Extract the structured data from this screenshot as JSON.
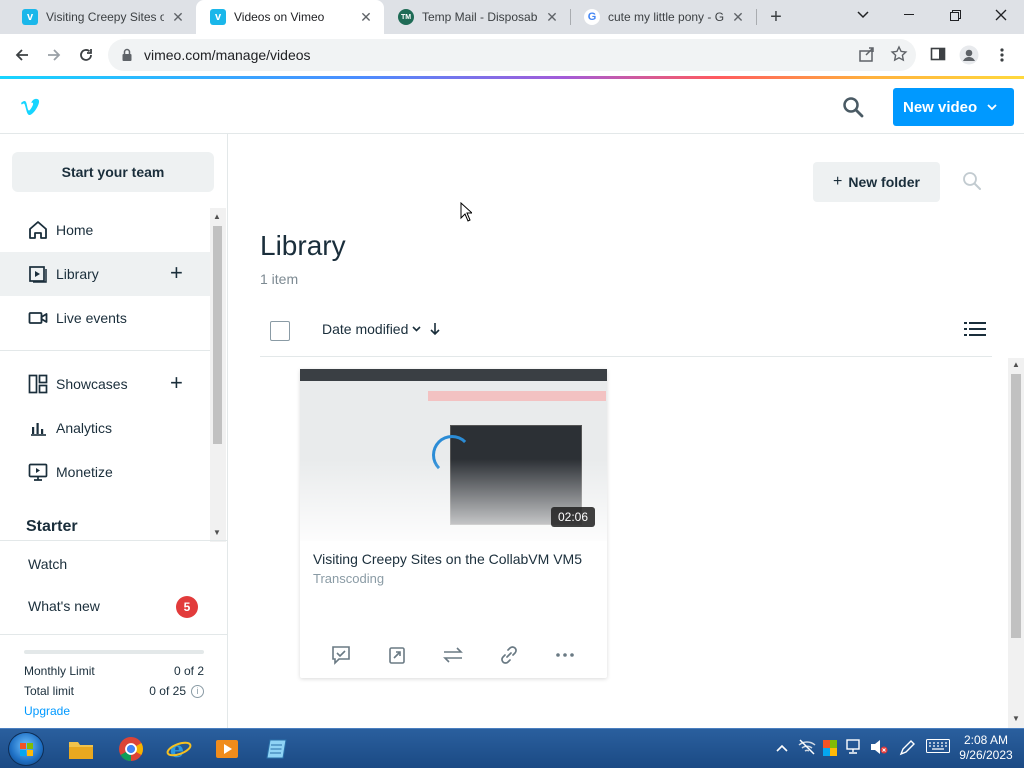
{
  "browser": {
    "tabs": [
      {
        "title": "Visiting Creepy Sites on",
        "favicon": "vimeo-icon",
        "active": false
      },
      {
        "title": "Videos on Vimeo",
        "favicon": "vimeo-icon",
        "active": true
      },
      {
        "title": "Temp Mail - Disposable",
        "favicon": "tempmail-icon",
        "active": false
      },
      {
        "title": "cute my little pony - Go",
        "favicon": "google-icon",
        "active": false
      }
    ],
    "url": "vimeo.com/manage/videos"
  },
  "header": {
    "logo": "v",
    "new_video_label": "New video"
  },
  "sidebar": {
    "start_team": "Start your team",
    "items": [
      {
        "label": "Home",
        "icon": "home-icon"
      },
      {
        "label": "Library",
        "icon": "library-icon",
        "active": true
      },
      {
        "label": "Live events",
        "icon": "camera-icon"
      },
      {
        "label": "Showcases",
        "icon": "showcase-icon"
      },
      {
        "label": "Analytics",
        "icon": "analytics-icon"
      },
      {
        "label": "Monetize",
        "icon": "monetize-icon"
      }
    ],
    "section_heading": "Starter",
    "watch": "Watch",
    "whats_new": "What's new",
    "whats_new_badge": "5",
    "limits": [
      {
        "label": "Monthly Limit",
        "value": "0 of 2"
      },
      {
        "label": "Total limit",
        "value": "0 of 25"
      }
    ],
    "upgrade": "Upgrade"
  },
  "main": {
    "new_folder": "New folder",
    "title": "Library",
    "count": "1 item",
    "sort_label": "Date modified",
    "sort_direction_icon": "arrow-down-icon"
  },
  "video": {
    "duration": "02:06",
    "title": "Visiting Creepy Sites on the CollabVM VM5",
    "status": "Transcoding"
  },
  "taskbar": {
    "time": "2:08 AM",
    "date": "9/26/2023"
  },
  "colors": {
    "vimeo_blue": "#0099ff",
    "badge_red": "#e23b3b",
    "text_dark": "#1a2e3b"
  }
}
